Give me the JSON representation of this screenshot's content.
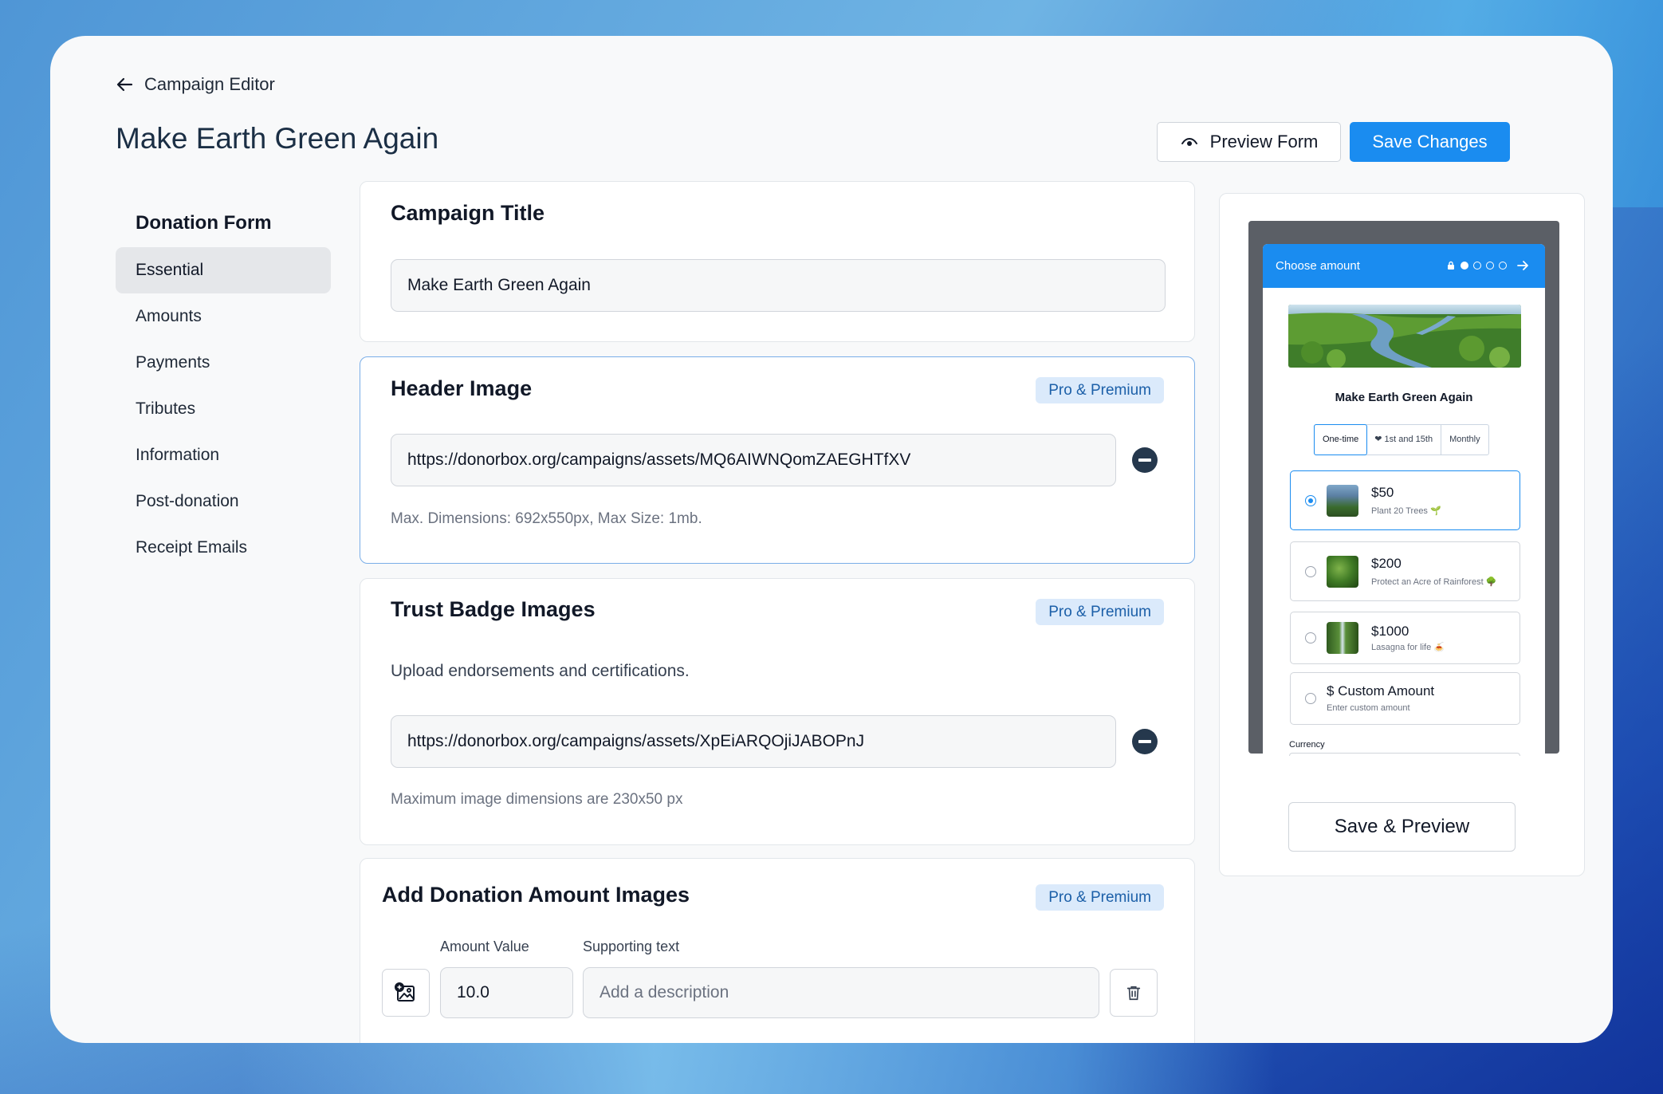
{
  "header": {
    "back_label": "Campaign Editor",
    "title": "Make Earth Green Again",
    "preview_button": "Preview Form",
    "save_button": "Save Changes"
  },
  "sidebar": {
    "heading": "Donation Form",
    "items": [
      {
        "label": "Essential",
        "active": true
      },
      {
        "label": "Amounts"
      },
      {
        "label": "Payments"
      },
      {
        "label": "Tributes"
      },
      {
        "label": "Information"
      },
      {
        "label": "Post-donation"
      },
      {
        "label": "Receipt Emails"
      }
    ]
  },
  "campaign_title": {
    "title": "Campaign Title",
    "value": "Make Earth Green Again"
  },
  "header_image": {
    "title": "Header Image",
    "badge": "Pro & Premium",
    "value": "https://donorbox.org/campaigns/assets/MQ6AIWNQomZAEGHTfXV",
    "hint": "Max. Dimensions: 692x550px, Max Size: 1mb."
  },
  "trust_badges": {
    "title": "Trust Badge Images",
    "badge": "Pro & Premium",
    "description": "Upload endorsements and certifications.",
    "value": "https://donorbox.org/campaigns/assets/XpEiARQOjiJABOPnJ",
    "hint": "Maximum image dimensions are 230x50 px"
  },
  "amount_images": {
    "title": "Add Donation Amount Images",
    "badge": "Pro & Premium",
    "amount_label": "Amount Value",
    "text_label": "Supporting text",
    "amount_value": "10.0",
    "text_placeholder": "Add a description"
  },
  "preview": {
    "header": "Choose amount",
    "campaign_title": "Make Earth Green Again",
    "frequencies": [
      "One-time",
      "❤ 1st and 15th",
      "Monthly"
    ],
    "amounts": [
      {
        "value": "$50",
        "sub": "Plant 20 Trees 🌱",
        "selected": true
      },
      {
        "value": "$200",
        "sub": "Protect an Acre of Rainforest 🌳"
      },
      {
        "value": "$1000",
        "sub": "Lasagna for life 🍝"
      },
      {
        "value": "$ Custom Amount",
        "sub": "Enter custom amount"
      }
    ],
    "currency_label": "Currency",
    "save_preview_button": "Save & Preview"
  },
  "colors": {
    "accent": "#1a8cf0",
    "badge_bg": "#dbeafb",
    "title_dark": "#1b2f45"
  }
}
